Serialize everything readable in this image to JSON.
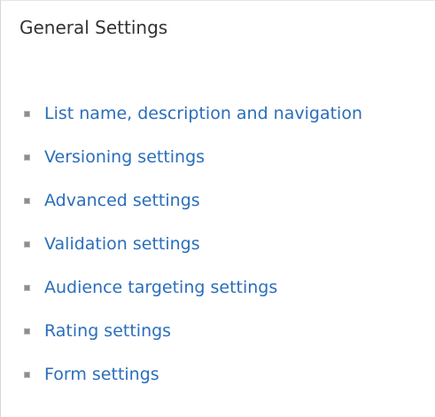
{
  "section": {
    "title": "General Settings",
    "links": [
      {
        "label": "List name, description and navigation"
      },
      {
        "label": "Versioning settings"
      },
      {
        "label": "Advanced settings"
      },
      {
        "label": "Validation settings"
      },
      {
        "label": "Audience targeting settings"
      },
      {
        "label": "Rating settings"
      },
      {
        "label": "Form settings"
      }
    ]
  },
  "colors": {
    "link": "#2a6ebb",
    "heading": "#333333",
    "bullet": "#8d8d8d"
  }
}
